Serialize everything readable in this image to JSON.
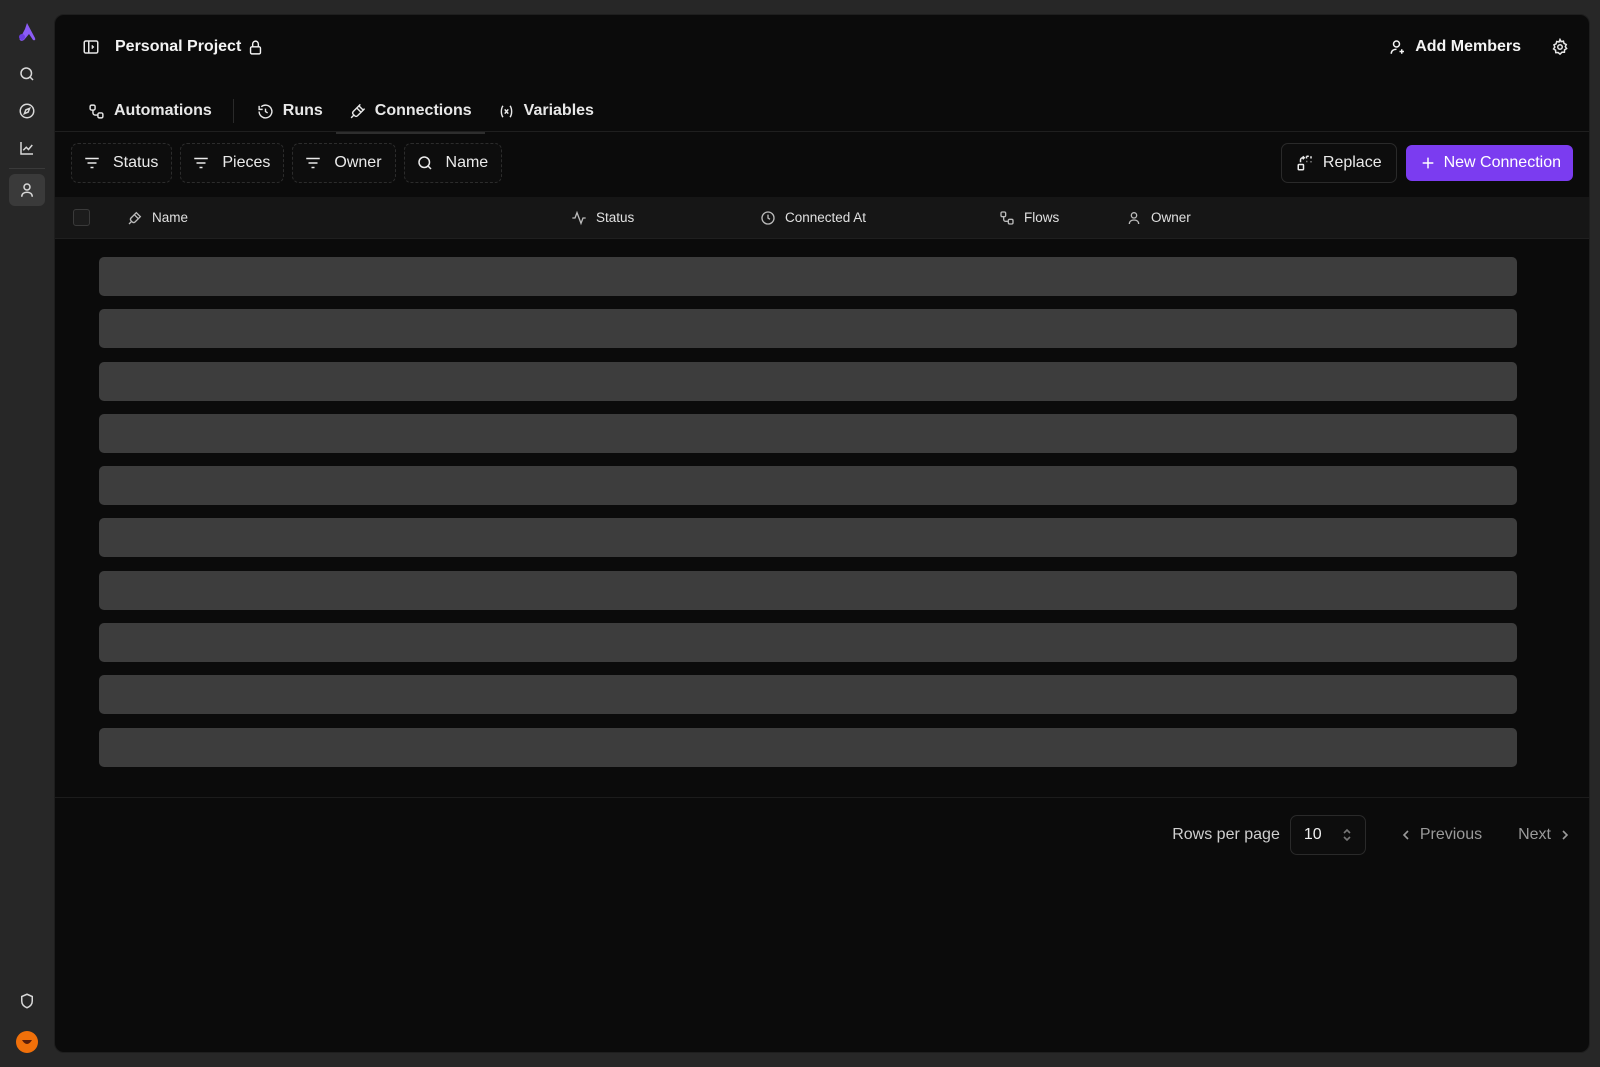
{
  "rail": {
    "logo": "brand-logo",
    "items": [
      {
        "name": "search",
        "icon": "search-icon"
      },
      {
        "name": "explore",
        "icon": "compass-icon"
      },
      {
        "name": "analytics",
        "icon": "chart-line-icon"
      },
      {
        "name": "users",
        "icon": "user-icon",
        "active": true
      }
    ],
    "bottom": [
      {
        "name": "security",
        "icon": "shield-icon"
      },
      {
        "name": "profile",
        "icon": "avatar-icon"
      }
    ]
  },
  "header": {
    "project_title": "Personal Project",
    "add_members_label": "Add Members"
  },
  "tabs": [
    {
      "label": "Automations",
      "icon": "automation-icon"
    },
    {
      "label": "Runs",
      "icon": "history-icon"
    },
    {
      "label": "Connections",
      "icon": "plug-icon",
      "active": true
    },
    {
      "label": "Variables",
      "icon": "variable-icon"
    }
  ],
  "toolbar": {
    "filters": [
      {
        "label": "Status",
        "icon": "filter-icon"
      },
      {
        "label": "Pieces",
        "icon": "filter-icon"
      },
      {
        "label": "Owner",
        "icon": "filter-icon"
      },
      {
        "label": "Name",
        "icon": "search-icon"
      }
    ],
    "replace_label": "Replace",
    "new_connection_label": "New Connection"
  },
  "table": {
    "columns": [
      {
        "label": "Name",
        "icon": "plug-icon"
      },
      {
        "label": "Status",
        "icon": "activity-icon"
      },
      {
        "label": "Connected At",
        "icon": "clock-icon"
      },
      {
        "label": "Flows",
        "icon": "flows-icon"
      },
      {
        "label": "Owner",
        "icon": "user-icon"
      }
    ],
    "loading_rows": 10
  },
  "pagination": {
    "rows_per_page_label": "Rows per page",
    "rows_per_page_value": "10",
    "previous_label": "Previous",
    "next_label": "Next"
  },
  "colors": {
    "accent": "#7b3cf0",
    "panel_bg": "#0b0b0b",
    "skeleton": "#3d3d3d",
    "logo": "#8b5cf6",
    "avatar": "#f0700a"
  }
}
